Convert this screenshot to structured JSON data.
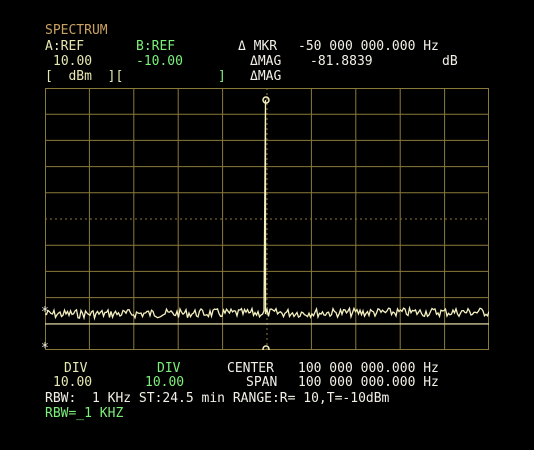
{
  "header": {
    "title": "SPECTRUM",
    "a_ref_label": "A:REF",
    "a_ref_value": "10.00",
    "a_unit": "[  dBm  ][",
    "b_ref_label": "B:REF",
    "b_ref_value": "-10.00",
    "b_unit_close": "]",
    "mkr_label": "Δ MKR",
    "mkr_value": "-50 000 000.000 Hz",
    "mag_label_1": "ΔMAG",
    "mag_value": "-81.8839",
    "mag_unit": "dB",
    "mag_label_2": "ΔMAG"
  },
  "footer": {
    "div_a_label": "DIV",
    "div_a_value": "10.00",
    "div_b_label": "DIV",
    "div_b_value": "10.00",
    "center_label": "CENTER",
    "center_value": "100 000 000.000 Hz",
    "span_label": "SPAN",
    "span_value": "100 000 000.000 Hz",
    "status_line": "RBW:  1 KHz ST:24.5 min RANGE:R= 10,T=-10dBm",
    "input_line": "RBW=_1 KHZ"
  },
  "markers": {
    "left_marker_glyph": "*"
  },
  "colors": {
    "title": "#c9a260",
    "channel_a": "#e6e8b0",
    "channel_b": "#7df07a",
    "grid": "#8a7a3a",
    "trace": "#f5f0c0"
  }
}
